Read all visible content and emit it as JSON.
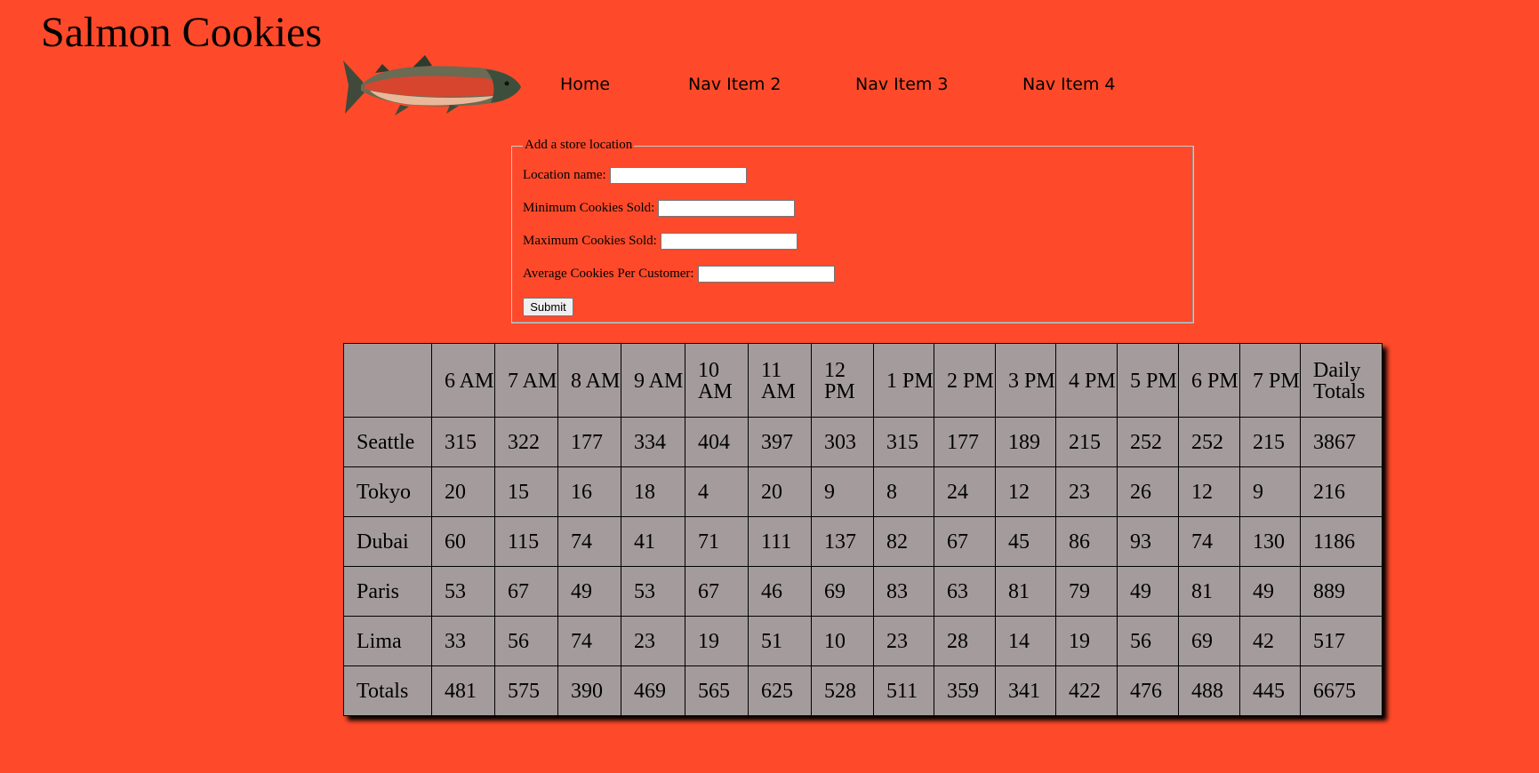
{
  "header": {
    "title": "Salmon Cookies"
  },
  "nav": {
    "items": [
      {
        "label": "Home"
      },
      {
        "label": "Nav Item 2"
      },
      {
        "label": "Nav Item 3"
      },
      {
        "label": "Nav Item 4"
      }
    ]
  },
  "form": {
    "legend": "Add a store location",
    "location_label": "Location name:",
    "location_value": "",
    "min_label": "Minimum Cookies Sold:",
    "min_value": "",
    "max_label": "Maximum Cookies Sold:",
    "max_value": "",
    "avg_label": "Average Cookies Per Customer:",
    "avg_value": "",
    "submit_label": "Submit"
  },
  "table": {
    "headers": [
      "",
      "6 AM",
      "7 AM",
      "8 AM",
      "9 AM",
      "10 AM",
      "11 AM",
      "12 PM",
      "1 PM",
      "2 PM",
      "3 PM",
      "4 PM",
      "5 PM",
      "6 PM",
      "7 PM",
      "Daily Totals"
    ],
    "rows": [
      {
        "name": "Seattle",
        "values": [
          "315",
          "322",
          "177",
          "334",
          "404",
          "397",
          "303",
          "315",
          "177",
          "189",
          "215",
          "252",
          "252",
          "215",
          "3867"
        ]
      },
      {
        "name": "Tokyo",
        "values": [
          "20",
          "15",
          "16",
          "18",
          "4",
          "20",
          "9",
          "8",
          "24",
          "12",
          "23",
          "26",
          "12",
          "9",
          "216"
        ]
      },
      {
        "name": "Dubai",
        "values": [
          "60",
          "115",
          "74",
          "41",
          "71",
          "111",
          "137",
          "82",
          "67",
          "45",
          "86",
          "93",
          "74",
          "130",
          "1186"
        ]
      },
      {
        "name": "Paris",
        "values": [
          "53",
          "67",
          "49",
          "53",
          "67",
          "46",
          "69",
          "83",
          "63",
          "81",
          "79",
          "49",
          "81",
          "49",
          "889"
        ]
      },
      {
        "name": "Lima",
        "values": [
          "33",
          "56",
          "74",
          "23",
          "19",
          "51",
          "10",
          "23",
          "28",
          "14",
          "19",
          "56",
          "69",
          "42",
          "517"
        ]
      }
    ],
    "totals": {
      "name": "Totals",
      "values": [
        "481",
        "575",
        "390",
        "469",
        "565",
        "625",
        "528",
        "511",
        "359",
        "341",
        "422",
        "476",
        "488",
        "445",
        "6675"
      ]
    }
  },
  "colors": {
    "page_background": "#fe4a2a",
    "table_background": "#a49c9c"
  }
}
